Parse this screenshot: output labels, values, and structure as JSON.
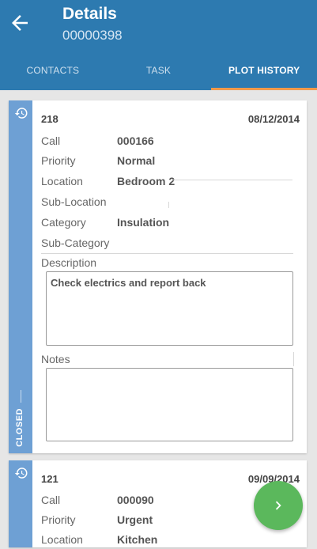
{
  "header": {
    "title": "Details",
    "subtitle": "00000398"
  },
  "tabs": [
    {
      "label": "CONTACTS",
      "active": false
    },
    {
      "label": "TASK",
      "active": false
    },
    {
      "label": "PLOT HISTORY",
      "active": true
    }
  ],
  "colors": {
    "appbar": "#2d7ab0",
    "tab_indicator": "#f29a4a",
    "status_strip": "#6ea0d4",
    "fab": "#5bb85c"
  },
  "cards": [
    {
      "number": "218",
      "date": "08/12/2014",
      "status": "CLOSED",
      "fields": {
        "call_label": "Call",
        "call": "000166",
        "priority_label": "Priority",
        "priority": "Normal",
        "location_label": "Location",
        "location": "Bedroom 2",
        "sublocation_label": "Sub-Location",
        "sublocation": "",
        "category_label": "Category",
        "category": "Insulation",
        "subcategory_label": "Sub-Category",
        "subcategory": ""
      },
      "description_label": "Description",
      "description": "Check electrics and report back",
      "notes_label": "Notes",
      "notes": ""
    },
    {
      "number": "121",
      "date": "09/09/2014",
      "fields": {
        "call_label": "Call",
        "call": "000090",
        "priority_label": "Priority",
        "priority": "Urgent",
        "location_label": "Location",
        "location": "Kitchen"
      }
    }
  ],
  "icons": {
    "back": "arrow-left-icon",
    "history": "history-icon",
    "fab": "chevron-right-icon"
  }
}
